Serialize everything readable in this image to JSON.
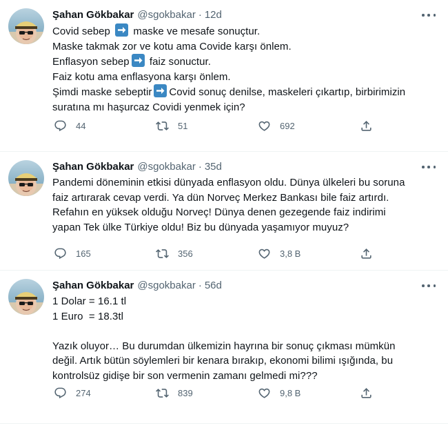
{
  "colors": {
    "text": "#0f1419",
    "muted": "#536471",
    "divider": "#eff3f4",
    "arrow_emoji": "#3b88c3"
  },
  "tweets": [
    {
      "name": "Şahan Gökbakar",
      "handle": "@sgokbakar",
      "dot": "·",
      "time": "12d",
      "lines": [
        {
          "before": "Covid sebep ",
          "arrow": true,
          "after": " maske ve mesafe sonuçtur."
        },
        {
          "before": "Maske takmak zor ve kotu ama Covide karşı önlem.",
          "arrow": false,
          "after": ""
        },
        {
          "before": "Enflasyon sebep",
          "arrow": true,
          "after": " faiz sonuctur."
        },
        {
          "before": "Faiz kotu ama enflasyona karşı önlem.",
          "arrow": false,
          "after": ""
        },
        {
          "before": "Şimdi maske sebeptir",
          "arrow": true,
          "after": "Covid sonuç denilse, maskeleri çıkartıp, birbirimizin"
        },
        {
          "before": "suratına mı haşurcaz Covidi yenmek için?",
          "arrow": false,
          "after": ""
        }
      ],
      "replies": "44",
      "retweets": "51",
      "likes": "692"
    },
    {
      "name": "Şahan Gökbakar",
      "handle": "@sgokbakar",
      "dot": "·",
      "time": "35d",
      "lines": [
        {
          "before": "Pandemi döneminin etkisi dünyada enflasyon oldu. Dünya ülkeleri bu soruna",
          "arrow": false,
          "after": ""
        },
        {
          "before": "faiz artırarak cevap verdi. Ya dün Norveç Merkez Bankası bile faiz artırdı.",
          "arrow": false,
          "after": ""
        },
        {
          "before": "Refahın en yüksek olduğu Norveç! Dünya denen gezegende faiz indirimi",
          "arrow": false,
          "after": ""
        },
        {
          "before": "yapan Tek ülke Türkiye oldu! Biz bu dünyada yaşamıyor muyuz?",
          "arrow": false,
          "after": ""
        }
      ],
      "replies": "165",
      "retweets": "356",
      "likes": "3,8 B"
    },
    {
      "name": "Şahan Gökbakar",
      "handle": "@sgokbakar",
      "dot": "·",
      "time": "56d",
      "lines": [
        {
          "before": "1 Dolar = 16.1 tl",
          "arrow": false,
          "after": ""
        },
        {
          "before": "1 Euro  = 18.3tl",
          "arrow": false,
          "after": ""
        },
        {
          "before": "",
          "arrow": false,
          "after": ""
        },
        {
          "before": "Yazık oluyor… Bu durumdan ülkemizin hayrına bir sonuç çıkması mümkün",
          "arrow": false,
          "after": ""
        },
        {
          "before": "değil. Artık bütün söylemleri bir kenara bırakıp, ekonomi bilimi ışığında, bu",
          "arrow": false,
          "after": ""
        },
        {
          "before": "kontrolsüz gidişe bir son vermenin zamanı gelmedi mi???",
          "arrow": false,
          "after": ""
        }
      ],
      "replies": "274",
      "retweets": "839",
      "likes": "9,8 B"
    }
  ],
  "icons": {
    "reply": "reply-icon",
    "retweet": "retweet-icon",
    "like": "like-icon",
    "share": "share-icon",
    "more": "more-icon",
    "arrow": "right-arrow-emoji-icon"
  }
}
